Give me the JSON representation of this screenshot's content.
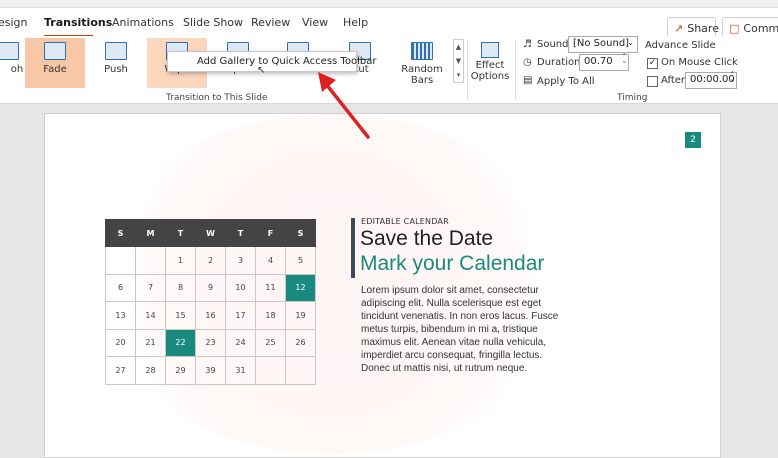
{
  "tabs": [
    "Transitions",
    "Animations",
    "Slide Show",
    "Review",
    "View",
    "Help"
  ],
  "left_tab_fragment": "esign",
  "share_label": "Share",
  "comments_label": "Commer",
  "gallery": {
    "items": [
      "Fade",
      "Push",
      "Wipe",
      "Split",
      "Reveal",
      "Cut",
      "Random Bars"
    ],
    "left_fragment": "oh",
    "group_label": "Transition to This Slide"
  },
  "effect_options": {
    "line1": "Effect",
    "line2": "Options"
  },
  "popup_text": "Add Gallery to Quick Access Toolbar",
  "timing": {
    "sound_label": "Sound:",
    "sound_value": "[No Sound]",
    "duration_label": "Duration:",
    "duration_value": "00.70",
    "apply_label": "Apply To All",
    "advance_label": "Advance Slide",
    "on_mouse_click_label": "On Mouse Click",
    "after_label": "After:",
    "after_value": "00:00.00",
    "group_label": "Timing"
  },
  "slide": {
    "number": "2",
    "eyebrow": "EDITABLE CALENDAR",
    "title_line1": "Save the Date",
    "title_line2": "Mark your Calendar",
    "body": "Lorem ipsum dolor sit amet, consectetur adipiscing elit. Nulla scelerisque est eget tincidunt venenatis. In non eros lacus. Fusce metus turpis, bibendum in mi a, tristique maximus elit. Aenean vitae nulla vehicula, imperdiet arcu consequat, fringilla lectus. Donec ut mattis nisi, ut rutrum neque.",
    "calendar": {
      "headers": [
        "S",
        "M",
        "T",
        "W",
        "T",
        "F",
        "S"
      ],
      "rows": [
        [
          "",
          "",
          "1",
          "2",
          "3",
          "4",
          "5"
        ],
        [
          "6",
          "7",
          "8",
          "9",
          "10",
          "11",
          "12"
        ],
        [
          "13",
          "14",
          "15",
          "16",
          "17",
          "18",
          "19"
        ],
        [
          "20",
          "21",
          "22",
          "23",
          "24",
          "25",
          "26"
        ],
        [
          "27",
          "28",
          "29",
          "39",
          "31",
          "",
          ""
        ]
      ],
      "highlighted": [
        "12",
        "22"
      ],
      "highlight_color": "#1a8a7e"
    }
  },
  "colors": {
    "accent": "#c43e1c",
    "teal": "#1a8a7e",
    "selected_gallery": "#f8c7a8",
    "arrow": "#e02020"
  }
}
